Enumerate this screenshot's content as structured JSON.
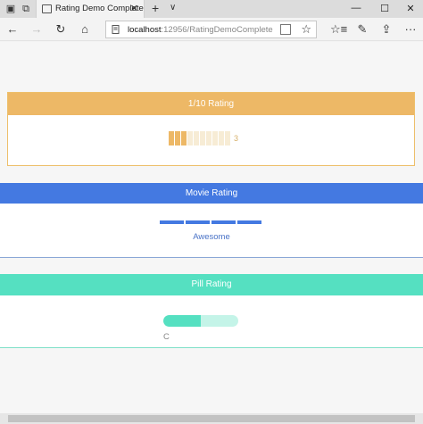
{
  "window": {
    "tab_title": "Rating Demo Complete",
    "new_tab_glyph": "+",
    "tab_menu_glyph": "∨",
    "minimize_glyph": "—",
    "maximize_glyph": "☐",
    "close_glyph": "✕",
    "tab_close_glyph": "✕"
  },
  "navbar": {
    "back_glyph": "←",
    "forward_glyph": "→",
    "refresh_glyph": "↻",
    "home_glyph": "⌂",
    "url_host": "localhost",
    "url_path": ":12956/RatingDemoComplete",
    "favorite_glyph": "☆",
    "hub_glyph": "☆≡",
    "notes_glyph": "✎",
    "share_glyph": "⇪",
    "more_glyph": "···"
  },
  "sections": {
    "tenth": {
      "title": "1/10 Rating",
      "value_text": "3",
      "total": 10,
      "selected": 3,
      "color": "#edb866"
    },
    "movie": {
      "title": "Movie Rating",
      "label": "Awesome",
      "total": 4,
      "selected": 4,
      "color": "#4479e1"
    },
    "pill": {
      "title": "Pill Rating",
      "label": "C",
      "fill_fraction": 0.5,
      "color": "#55e0c1"
    }
  }
}
